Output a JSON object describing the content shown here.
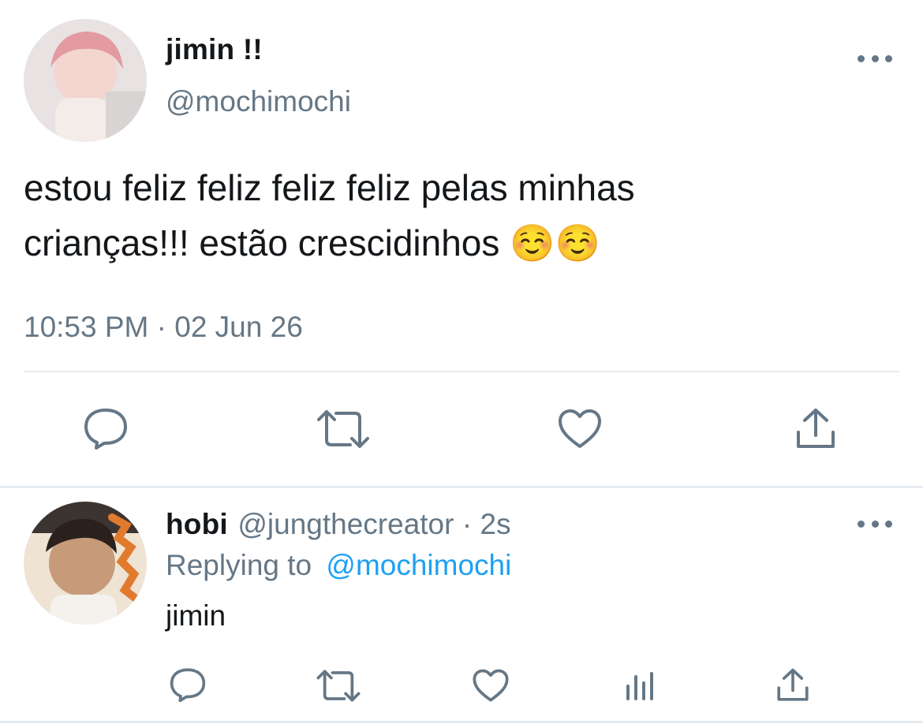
{
  "tweet": {
    "display_name": "jimin !!",
    "handle": "@mochimochi",
    "text_line1": "estou feliz feliz feliz feliz pelas minhas",
    "text_line2": "crianças!!! estão crescidinhos ☺️☺️",
    "timestamp": "10:53 PM · 02 Jun 26",
    "actions": [
      "reply-icon",
      "retweet-icon",
      "like-icon",
      "share-icon"
    ]
  },
  "reply": {
    "display_name": "hobi",
    "handle": "@jungthecreator",
    "time": "· 2s",
    "replying_prefix": "Replying to",
    "replying_handle": "@mochimochi",
    "text": "jimin",
    "actions": [
      "reply-icon",
      "retweet-icon",
      "like-icon",
      "analytics-icon",
      "share-icon"
    ]
  },
  "colors": {
    "text": "#14171a",
    "secondary": "#657786",
    "accent": "#1da1f2",
    "divider": "#e6ecf0"
  }
}
